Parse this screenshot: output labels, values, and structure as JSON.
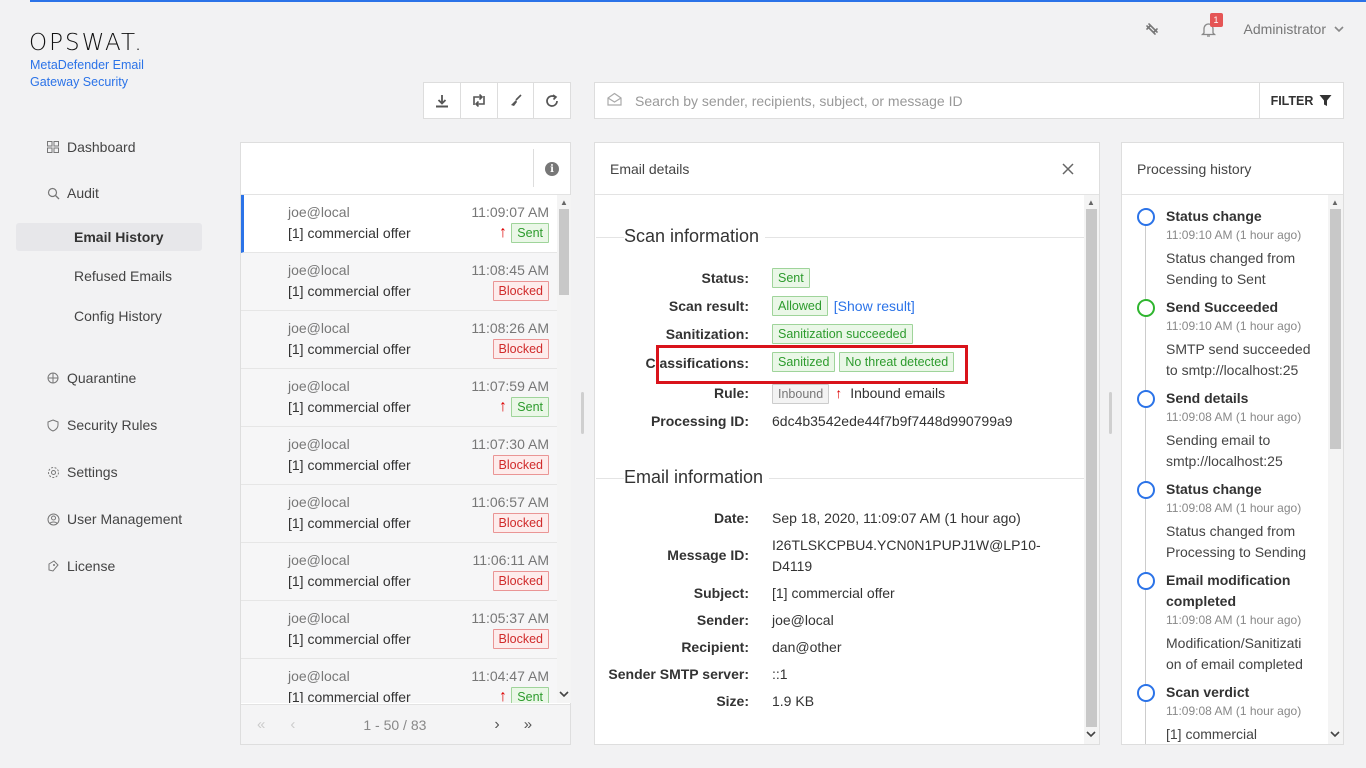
{
  "brand": {
    "logo": "OPSWAT.",
    "product": "MetaDefender Email Gateway Security"
  },
  "header": {
    "notification_count": "1",
    "user": "Administrator"
  },
  "sidebar": {
    "dashboard": "Dashboard",
    "audit": "Audit",
    "audit_items": [
      "Email History",
      "Refused Emails",
      "Config History"
    ],
    "quarantine": "Quarantine",
    "security_rules": "Security Rules",
    "settings": "Settings",
    "user_management": "User Management",
    "license": "License"
  },
  "toolbar": {
    "search_placeholder": "Search by sender, recipients, subject, or message ID",
    "filter_label": "FILTER"
  },
  "email_list": {
    "rows": [
      {
        "from": "joe@local",
        "time": "11:09:07 AM",
        "subject": "[1] commercial offer",
        "status": "Sent"
      },
      {
        "from": "joe@local",
        "time": "11:08:45 AM",
        "subject": "[1] commercial offer",
        "status": "Blocked"
      },
      {
        "from": "joe@local",
        "time": "11:08:26 AM",
        "subject": "[1] commercial offer",
        "status": "Blocked"
      },
      {
        "from": "joe@local",
        "time": "11:07:59 AM",
        "subject": "[1] commercial offer",
        "status": "Sent"
      },
      {
        "from": "joe@local",
        "time": "11:07:30 AM",
        "subject": "[1] commercial offer",
        "status": "Blocked"
      },
      {
        "from": "joe@local",
        "time": "11:06:57 AM",
        "subject": "[1] commercial offer",
        "status": "Blocked"
      },
      {
        "from": "joe@local",
        "time": "11:06:11 AM",
        "subject": "[1] commercial offer",
        "status": "Blocked"
      },
      {
        "from": "joe@local",
        "time": "11:05:37 AM",
        "subject": "[1] commercial offer",
        "status": "Blocked"
      },
      {
        "from": "joe@local",
        "time": "11:04:47 AM",
        "subject": "[1] commercial offer",
        "status": "Sent"
      }
    ],
    "pagination": "1 - 50 / 83"
  },
  "details": {
    "title": "Email details",
    "scan_section": "Scan information",
    "status_label": "Status:",
    "status_value": "Sent",
    "scan_result_label": "Scan result:",
    "scan_result_value": "Allowed",
    "show_result": "[Show result]",
    "sanitization_label": "Sanitization:",
    "sanitization_value": "Sanitization succeeded",
    "classifications_label": "Classifications:",
    "classification_1": "Sanitized",
    "classification_2": "No threat detected",
    "rule_label": "Rule:",
    "rule_badge": "Inbound",
    "rule_value": "Inbound emails",
    "processing_id_label": "Processing ID:",
    "processing_id_value": "6dc4b3542ede44f7b9f7448d990799a9",
    "email_section": "Email information",
    "date_label": "Date:",
    "date_value": "Sep 18, 2020, 11:09:07 AM (1 hour ago)",
    "message_id_label": "Message ID:",
    "message_id_line1": "I26TLSKCPBU4.YCN0N1PUPJ1W@LP10-",
    "message_id_line2": "D4119",
    "subject_label": "Subject:",
    "subject_value": "[1] commercial offer",
    "sender_label": "Sender:",
    "sender_value": "joe@local",
    "recipient_label": "Recipient:",
    "recipient_value": "dan@other",
    "smtp_label": "Sender SMTP server:",
    "smtp_value": "::1",
    "size_label": "Size:",
    "size_value": "1.9 KB"
  },
  "history": {
    "title": "Processing history",
    "items": [
      {
        "title": "Status change",
        "time": "11:09:10 AM (1 hour ago)",
        "text1": "Status changed from",
        "text2": "Sending to Sent"
      },
      {
        "title": "Send Succeeded",
        "time": "11:09:10 AM (1 hour ago)",
        "text1": "SMTP send succeeded",
        "text2": "to smtp://localhost:25"
      },
      {
        "title": "Send details",
        "time": "11:09:08 AM (1 hour ago)",
        "text1": "Sending email to",
        "text2": "smtp://localhost:25"
      },
      {
        "title": "Status change",
        "time": "11:09:08 AM (1 hour ago)",
        "text1": "Status changed from",
        "text2": "Processing to Sending"
      },
      {
        "title": "Email modification",
        "title2": "completed",
        "time": "11:09:08 AM (1 hour ago)",
        "text1": "Modification/Sanitizati",
        "text2": "on of email completed"
      },
      {
        "title": "Scan verdict",
        "time": "11:09:08 AM (1 hour ago)",
        "text1": "[1] commercial"
      }
    ]
  },
  "colors": {
    "accent": "#2b73e8",
    "sent": "#2d9b2d",
    "blocked": "#d02b2b",
    "highlight": "#d9131b"
  }
}
